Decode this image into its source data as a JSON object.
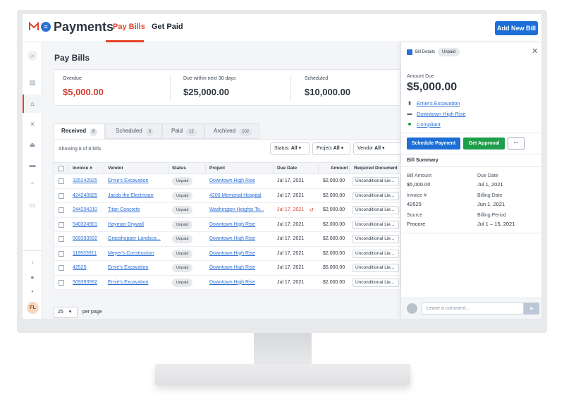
{
  "app": {
    "title": "Payments",
    "tabs": [
      "Pay Bills",
      "Get Paid"
    ],
    "add_button": "Add New Bill",
    "user_initials": "FL"
  },
  "page": {
    "title": "Pay Bills"
  },
  "summary": [
    {
      "label": "Overdue",
      "value": "$5,000.00",
      "color": "#d23f2f"
    },
    {
      "label": "Due within next 30 days",
      "value": "$25,000.00",
      "color": "#2d3640"
    },
    {
      "label": "Scheduled",
      "value": "$10,000.00",
      "color": "#2d3640"
    }
  ],
  "filter_tabs": [
    {
      "label": "Received",
      "count": "8"
    },
    {
      "label": "Scheduled",
      "count": "3"
    },
    {
      "label": "Paid",
      "count": "12"
    },
    {
      "label": "Archived",
      "count": "102"
    }
  ],
  "table": {
    "showing": "Showing 8 of 8 bills",
    "filters": [
      {
        "label": "Status:",
        "value": "All"
      },
      {
        "label": "Project",
        "value": "All"
      },
      {
        "label": "Vendor",
        "value": "All"
      }
    ],
    "columns": [
      "Invoice #",
      "Vendor",
      "Status",
      "Project",
      "Due Date",
      "Amount",
      "Required Document"
    ],
    "rows": [
      {
        "invoice": "325242825",
        "vendor": "Ernie's Excavation",
        "status": "Unpaid",
        "project": "Downtown High Rise",
        "due": "Jul 17, 2021",
        "amount": "$2,000.00",
        "doc": "Unconditional Lie...",
        "overdue": false
      },
      {
        "invoice": "424240825",
        "vendor": "Jacob the Electrician",
        "status": "Unpaid",
        "project": "4200 Memorial Hospital",
        "due": "Jul 17, 2021",
        "amount": "$2,000.00",
        "doc": "Unconditional Lie...",
        "overdue": false
      },
      {
        "invoice": "244204210",
        "vendor": "Titan Concrete",
        "status": "Unpaid",
        "project": "Washington Heights To...",
        "due": "Jul 17, 2021",
        "amount": "$2,000.00",
        "doc": "Unconditional Lie...",
        "overdue": true
      },
      {
        "invoice": "540324901",
        "vendor": "Hayman Drywall",
        "status": "Unpaid",
        "project": "Downtown High Rise",
        "due": "Jul 17, 2021",
        "amount": "$2,000.00",
        "doc": "Unconditional Lie...",
        "overdue": false
      },
      {
        "invoice": "509393592",
        "vendor": "Grasshopper Landsca...",
        "status": "Unpaid",
        "project": "Downtown High Rise",
        "due": "Jul 17, 2021",
        "amount": "$2,000.00",
        "doc": "Unconditional Lie...",
        "overdue": false
      },
      {
        "invoice": "119933911",
        "vendor": "Meyer's Construction",
        "status": "Unpaid",
        "project": "Downtown High Rise",
        "due": "Jul 17, 2021",
        "amount": "$2,000.00",
        "doc": "Unconditional Lie...",
        "overdue": false
      },
      {
        "invoice": "42525",
        "vendor": "Ernie's Excavation",
        "status": "Unpaid",
        "project": "Downtown High Rise",
        "due": "Jul 17, 2021",
        "amount": "$5,000.00",
        "doc": "Unconditional Lie...",
        "overdue": false
      },
      {
        "invoice": "509393592",
        "vendor": "Ernie's Excavation",
        "status": "Unpaid",
        "project": "Downtown High Rise",
        "due": "Jul 17, 2021",
        "amount": "$2,000.00",
        "doc": "Unconditional Lie...",
        "overdue": false
      }
    ],
    "per_page": "25",
    "per_page_label": "per page"
  },
  "panel": {
    "title": "Bill Details",
    "status": "Unpaid",
    "amount_label": "Amount Due",
    "amount": "$5,000.00",
    "vendor": "Ernie's Excavation",
    "project": "Downtown High Rise",
    "compliance": "Compliant",
    "schedule_button": "Schedule Payment",
    "approval_button": "Get Approval",
    "more_button": "···",
    "summary_title": "Bill Summary",
    "fields": [
      {
        "label": "Bill Amount",
        "value": "$5,000.00"
      },
      {
        "label": "Due Date",
        "value": "Jul 1, 2021"
      },
      {
        "label": "Invoice #",
        "value": "42525"
      },
      {
        "label": "Billing Date",
        "value": "Jun 1, 2021"
      },
      {
        "label": "Source",
        "value": "Procore"
      },
      {
        "label": "Billing Period",
        "value": "Jul 1 – 15, 2021"
      }
    ],
    "comment_placeholder": "Leave a comment..."
  },
  "colors": {
    "accent": "#e5432c",
    "primary": "#1d6fd6",
    "approve": "#1e9e4a",
    "overdue": "#d23f2f"
  }
}
